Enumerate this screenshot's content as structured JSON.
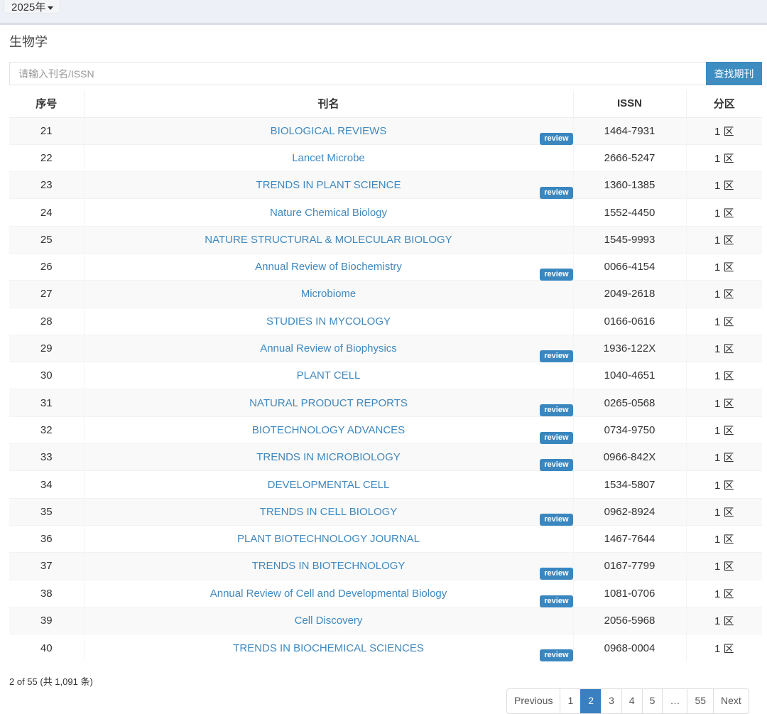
{
  "year_select": "2025年",
  "subject": "生物学",
  "search": {
    "placeholder": "请输入刊名/ISSN",
    "button": "查找期刊"
  },
  "columns": [
    "序号",
    "刊名",
    "ISSN",
    "分区"
  ],
  "badge_label": "review",
  "rows": [
    {
      "no": "21",
      "name": "BIOLOGICAL REVIEWS",
      "issn": "1464-7931",
      "zone": "1 区",
      "review": true
    },
    {
      "no": "22",
      "name": "Lancet Microbe",
      "issn": "2666-5247",
      "zone": "1 区",
      "review": false
    },
    {
      "no": "23",
      "name": "TRENDS IN PLANT SCIENCE",
      "issn": "1360-1385",
      "zone": "1 区",
      "review": true
    },
    {
      "no": "24",
      "name": "Nature Chemical Biology",
      "issn": "1552-4450",
      "zone": "1 区",
      "review": false
    },
    {
      "no": "25",
      "name": "NATURE STRUCTURAL & MOLECULAR BIOLOGY",
      "issn": "1545-9993",
      "zone": "1 区",
      "review": false
    },
    {
      "no": "26",
      "name": "Annual Review of Biochemistry",
      "issn": "0066-4154",
      "zone": "1 区",
      "review": true
    },
    {
      "no": "27",
      "name": "Microbiome",
      "issn": "2049-2618",
      "zone": "1 区",
      "review": false
    },
    {
      "no": "28",
      "name": "STUDIES IN MYCOLOGY",
      "issn": "0166-0616",
      "zone": "1 区",
      "review": false
    },
    {
      "no": "29",
      "name": "Annual Review of Biophysics",
      "issn": "1936-122X",
      "zone": "1 区",
      "review": true
    },
    {
      "no": "30",
      "name": "PLANT CELL",
      "issn": "1040-4651",
      "zone": "1 区",
      "review": false
    },
    {
      "no": "31",
      "name": "NATURAL PRODUCT REPORTS",
      "issn": "0265-0568",
      "zone": "1 区",
      "review": true
    },
    {
      "no": "32",
      "name": "BIOTECHNOLOGY ADVANCES",
      "issn": "0734-9750",
      "zone": "1 区",
      "review": true
    },
    {
      "no": "33",
      "name": "TRENDS IN MICROBIOLOGY",
      "issn": "0966-842X",
      "zone": "1 区",
      "review": true
    },
    {
      "no": "34",
      "name": "DEVELOPMENTAL CELL",
      "issn": "1534-5807",
      "zone": "1 区",
      "review": false
    },
    {
      "no": "35",
      "name": "TRENDS IN CELL BIOLOGY",
      "issn": "0962-8924",
      "zone": "1 区",
      "review": true
    },
    {
      "no": "36",
      "name": "PLANT BIOTECHNOLOGY JOURNAL",
      "issn": "1467-7644",
      "zone": "1 区",
      "review": false
    },
    {
      "no": "37",
      "name": "TRENDS IN BIOTECHNOLOGY",
      "issn": "0167-7799",
      "zone": "1 区",
      "review": true
    },
    {
      "no": "38",
      "name": "Annual Review of Cell and Developmental Biology",
      "issn": "1081-0706",
      "zone": "1 区",
      "review": true
    },
    {
      "no": "39",
      "name": "Cell Discovery",
      "issn": "2056-5968",
      "zone": "1 区",
      "review": false
    },
    {
      "no": "40",
      "name": "TRENDS IN BIOCHEMICAL SCIENCES",
      "issn": "0968-0004",
      "zone": "1 区",
      "review": true
    }
  ],
  "page_info": "2 of 55 (共 1,091 条)",
  "pagination": [
    "Previous",
    "1",
    "2",
    "3",
    "4",
    "5",
    "…",
    "55",
    "Next"
  ],
  "active_page": "2"
}
